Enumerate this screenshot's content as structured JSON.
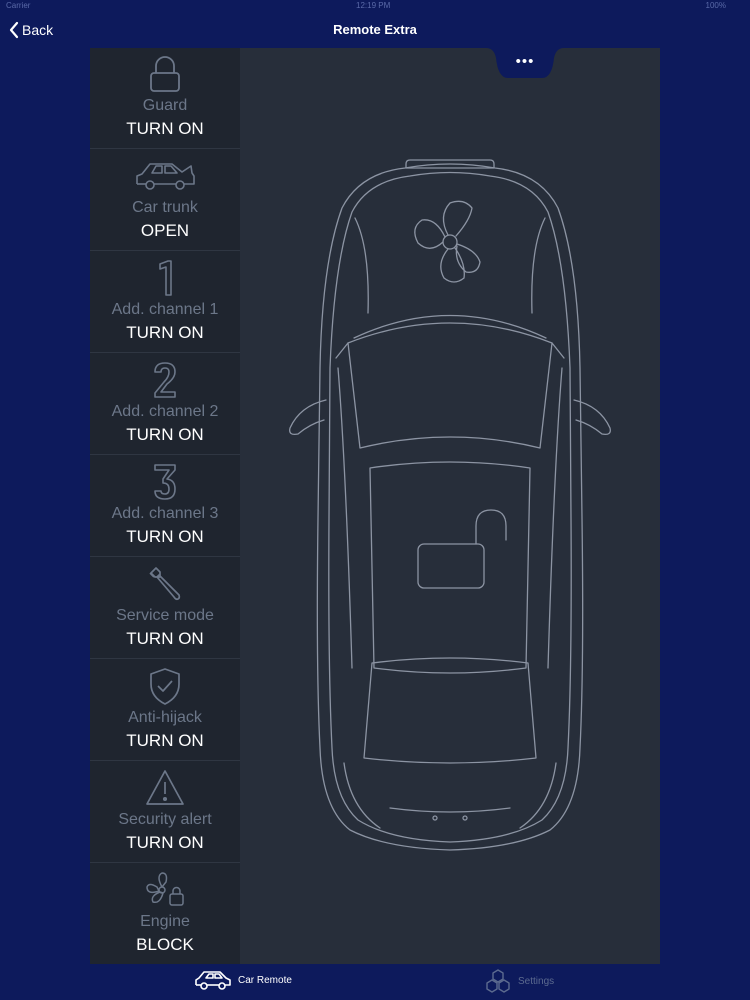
{
  "status_bar": {
    "carrier": "Carrier",
    "time": "12:19 PM",
    "battery": "100%"
  },
  "nav": {
    "back_label": "Back",
    "title": "Remote Extra"
  },
  "more_label": "•••",
  "sidebar": {
    "items": [
      {
        "label": "Guard",
        "action": "TURN ON",
        "icon": "lock-icon"
      },
      {
        "label": "Car trunk",
        "action": "OPEN",
        "icon": "car-trunk-icon"
      },
      {
        "label": "Add. channel 1",
        "action": "TURN ON",
        "icon": "channel-1-icon"
      },
      {
        "label": "Add. channel 2",
        "action": "TURN ON",
        "icon": "channel-2-icon"
      },
      {
        "label": "Add. channel 3",
        "action": "TURN ON",
        "icon": "channel-3-icon"
      },
      {
        "label": "Service mode",
        "action": "TURN ON",
        "icon": "wrench-icon"
      },
      {
        "label": "Anti-hijack",
        "action": "TURN ON",
        "icon": "shield-icon"
      },
      {
        "label": "Security alert",
        "action": "TURN ON",
        "icon": "warning-icon"
      },
      {
        "label": "Engine",
        "action": "BLOCK",
        "icon": "fan-lock-icon"
      }
    ]
  },
  "car": {
    "fan_icon": "fan-icon",
    "lock_state_icon": "unlocked-padlock-icon"
  },
  "tab_bar": {
    "tabs": [
      {
        "label": "Car Remote",
        "icon": "car-icon",
        "active": true
      },
      {
        "label": "Settings",
        "icon": "settings-cubes-icon",
        "active": false
      }
    ]
  },
  "colors": {
    "background": "#0d1a5c",
    "panel": "#272e3a",
    "sidebar": "#1f252f",
    "line_art": "#8c94a3",
    "muted_text": "#6c7789"
  }
}
